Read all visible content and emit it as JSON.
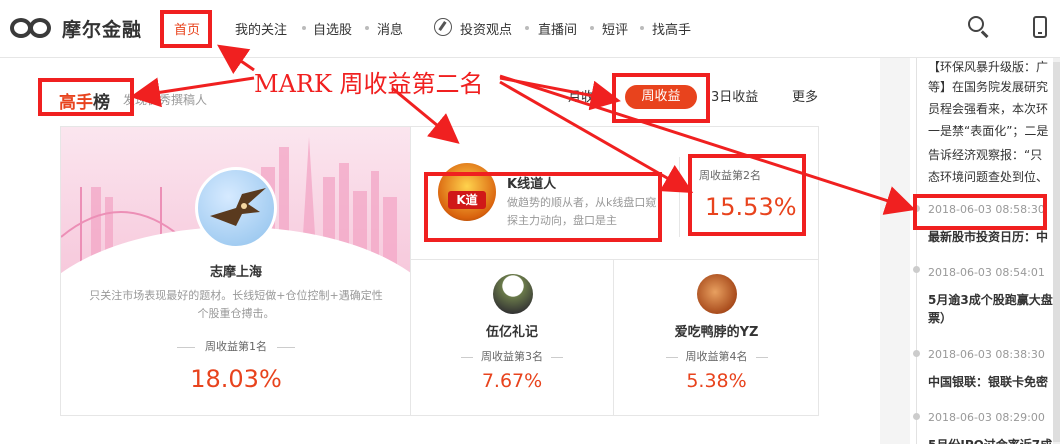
{
  "brand": {
    "name": "摩尔金融"
  },
  "nav": {
    "items": [
      "首页",
      "我的关注",
      "自选股",
      "消息",
      "投资观点",
      "直播间",
      "短评",
      "找高手"
    ],
    "active": "首页"
  },
  "section": {
    "title_highlight": "高手",
    "title_rest": "榜",
    "subtitle": "发现优秀撰稿人"
  },
  "tabs": {
    "items": [
      "月收益",
      "周收益",
      "3日收益",
      "更多"
    ],
    "active": "周收益"
  },
  "leaderboard": [
    {
      "name": "志摩上海",
      "desc": "只关注市场表现最好的题材。长线短做+仓位控制+遇确定性个股重仓搏击。",
      "rank": "周收益第1名",
      "return_pct": "18.03%"
    },
    {
      "name": "K线道人",
      "desc": "做趋势的顺从者，从k线盘口窥探主力动向，盘口是主",
      "rank": "周收益第2名",
      "return_pct": "15.53%",
      "avatar_text": "K道"
    },
    {
      "name": "伍亿礼记",
      "rank": "周收益第3名",
      "return_pct": "7.67%"
    },
    {
      "name": "爱吃鸭脖的YZ",
      "rank": "周收益第4名",
      "return_pct": "5.38%"
    }
  ],
  "feed": {
    "top_lines": [
      "【环保风暴升级版：广",
      "等】在国务院发展研究",
      "员程会强看来，本次环",
      "一是禁“表面化”；二是",
      "告诉经济观察报：“只",
      "态环境问题查处到位、"
    ],
    "items": [
      {
        "time": "2018-06-03 08:58:30",
        "title": "最新股市投资日历：中"
      },
      {
        "time": "2018-06-03 08:54:01",
        "title": "5月逾3成个股跑赢大盘",
        "title2": "票）"
      },
      {
        "time": "2018-06-03 08:38:30",
        "title": "中国银联：银联卡免密"
      },
      {
        "time": "2018-06-03 08:29:00",
        "title": "5月份IPO过会率近7成"
      }
    ]
  },
  "annotation": {
    "text": "MARK  周收益第二名",
    "color": "#f02020"
  },
  "colors": {
    "accent": "#e8431d",
    "annotation": "#f02020"
  },
  "icons": [
    "logo-icon",
    "compass-icon",
    "search-icon",
    "phone-icon"
  ]
}
